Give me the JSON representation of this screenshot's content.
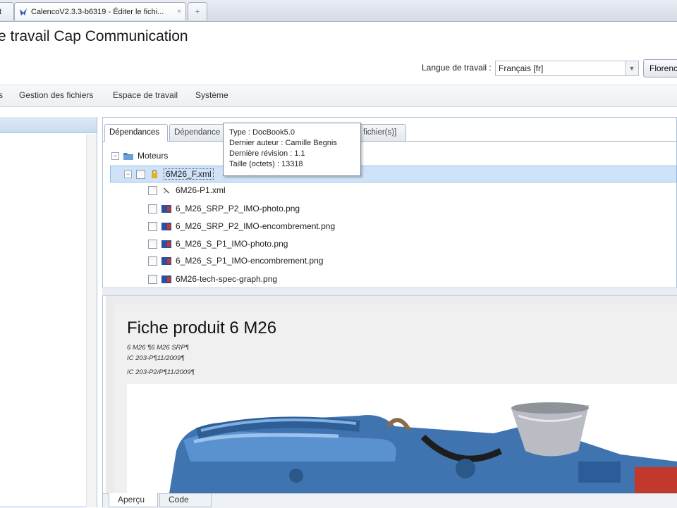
{
  "browser": {
    "tabs": [
      {
        "label": "t"
      },
      {
        "label": "CalencoV2.3.3-b6319 - Éditer le fichi...",
        "close": "×"
      },
      {
        "label": "+"
      }
    ]
  },
  "header": {
    "title": "e travail Cap Communication",
    "language_label": "Langue de travail :",
    "language_value": "Français [fr]",
    "user_button": "Florence"
  },
  "menu": {
    "items": [
      "s",
      "Gestion des fichiers",
      "Espace de travail",
      "Système"
    ]
  },
  "detail_tabs": [
    "Dépendances",
    "Dépendance",
    "fichier(s)]"
  ],
  "tooltip": {
    "type": "Type : DocBook5.0",
    "author": "Dernier auteur : Camille Begnis",
    "revision": "Dernière révision : 1.1",
    "size": "Taille (octets) : 13318"
  },
  "tree": {
    "root_label": "Moteurs",
    "selected_file": "6M26_F.xml",
    "children": [
      {
        "label": "6M26-P1.xml",
        "icon": "xml-file-icon"
      },
      {
        "label": "6_M26_SRP_P2_IMO-photo.png",
        "icon": "image-file-icon"
      },
      {
        "label": "6_M26_SRP_P2_IMO-encombrement.png",
        "icon": "image-file-icon"
      },
      {
        "label": "6_M26_S_P1_IMO-photo.png",
        "icon": "image-file-icon"
      },
      {
        "label": "6_M26_S_P1_IMO-encombrement.png",
        "icon": "image-file-icon"
      },
      {
        "label": "6M26-tech-spec-graph.png",
        "icon": "image-file-icon"
      }
    ]
  },
  "preview": {
    "title": "Fiche produit 6 M26",
    "meta_lines": [
      "6 M26 ¶6 M26 SRP¶",
      "IC 203-P¶11/2009¶",
      "IC 203-P2/P¶11/2009¶"
    ]
  },
  "bottom_tabs": [
    "Aperçu",
    "Code"
  ],
  "colors": {
    "selection": "#cfe3f8",
    "engine_blue": "#3f74b0"
  }
}
